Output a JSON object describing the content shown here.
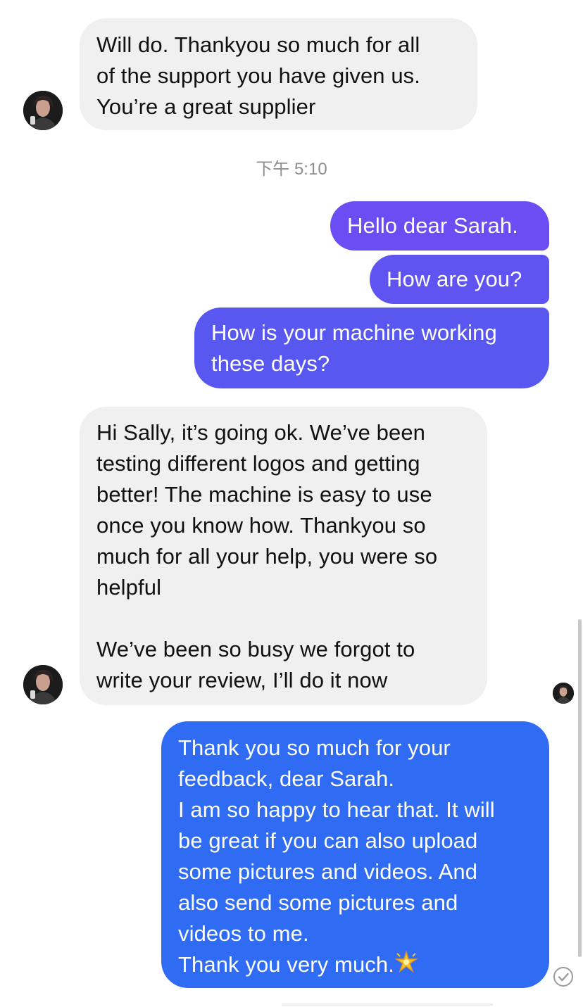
{
  "conversation": {
    "timestamp": "下午 5:10",
    "messages": [
      {
        "direction": "incoming",
        "text": "Will do. Thankyou so much for all\nof the support you have given us.\nYou’re a great supplier"
      },
      {
        "direction": "outgoing",
        "text": "Hello dear Sarah."
      },
      {
        "direction": "outgoing",
        "text": "How are you?"
      },
      {
        "direction": "outgoing",
        "text": "How is your machine working\nthese days?"
      },
      {
        "direction": "incoming",
        "text": "Hi Sally, it’s going ok. We’ve been\ntesting different logos and getting\nbetter! The machine is easy to use\nonce you know how. Thankyou so\nmuch for all your help, you were so\nhelpful\n\nWe’ve been so busy we forgot to\nwrite your review, I’ll do it now"
      },
      {
        "direction": "outgoing",
        "text": "Thank you so much for your\nfeedback, dear Sarah.\nI am so happy to hear that. It will\nbe great if you can also upload\nsome pictures and videos. And\nalso send some pictures and\nvideos to me.\nThank you very much."
      }
    ]
  },
  "icons": {
    "avatar": "contact-avatar",
    "seen": "seen-check-icon",
    "emoji": "glowing-star-emoji"
  },
  "colors": {
    "incoming_bubble": "#f0f0f0",
    "outgoing_purple": "#6b4ef2",
    "outgoing_blue": "#2f6ff2",
    "timestamp": "#8e8e93"
  }
}
